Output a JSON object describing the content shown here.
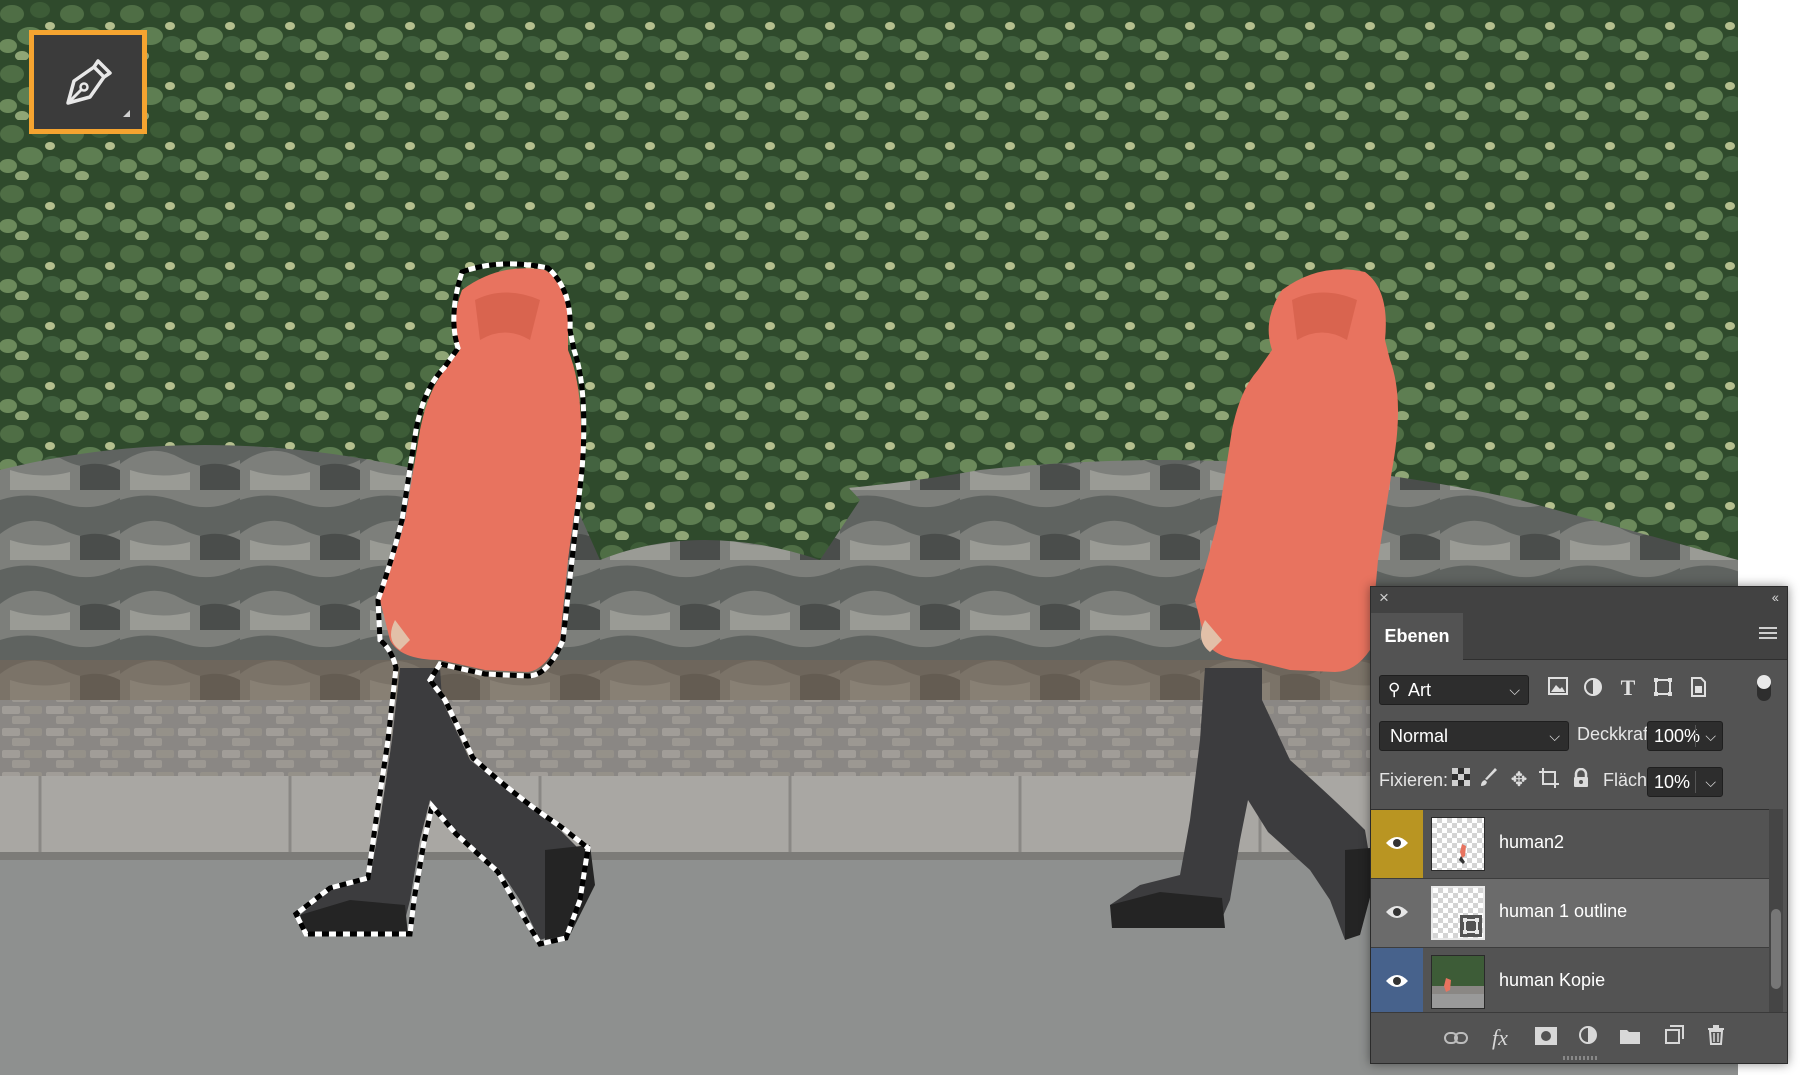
{
  "tool": {
    "icon": "pen-tool-icon"
  },
  "panel": {
    "close_icon": "×",
    "collapse_icon": "‹‹",
    "tab": "Ebenen",
    "filter": {
      "kind": "Art",
      "icons": [
        "image-filter-icon",
        "adjustment-filter-icon",
        "type-filter-icon",
        "shape-filter-icon",
        "smart-object-filter-icon"
      ]
    },
    "blend_mode": "Normal",
    "opacity_label": "Deckkraft:",
    "opacity_value": "100%",
    "lock_label": "Fixieren:",
    "fill_label": "Fläche:",
    "fill_value": "10%",
    "layers": [
      {
        "name": "human2",
        "visible": true,
        "color_tag": "#b99522"
      },
      {
        "name": "human 1 outline",
        "visible": true,
        "selected": true
      },
      {
        "name": "human Kopie",
        "visible": true,
        "color_tag": "#47628c"
      }
    ],
    "bottom_icons": [
      "link-icon",
      "fx-icon",
      "mask-icon",
      "adjustment-icon",
      "folder-icon",
      "new-layer-icon",
      "trash-icon"
    ],
    "fx_label": "fx"
  },
  "colors": {
    "accent_orange": "#f5a430",
    "panel_bg": "#535353",
    "jacket": "#e8735f"
  }
}
